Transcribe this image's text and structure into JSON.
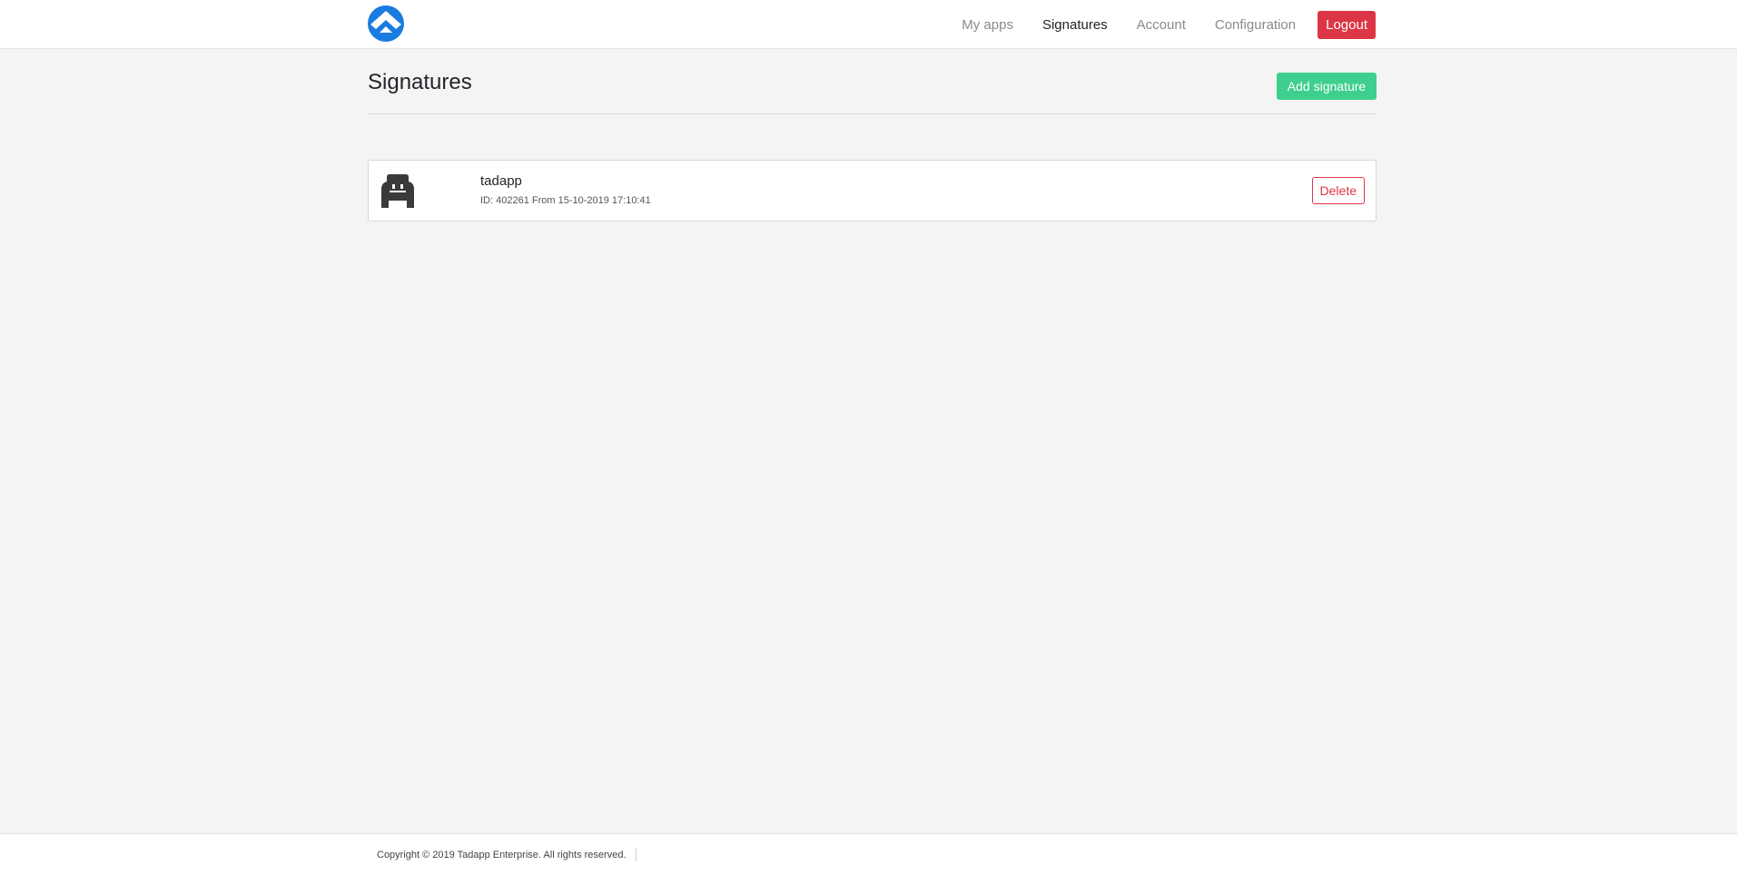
{
  "header": {
    "logo_icon": "app-logo-icon",
    "brand_color": "#1a7be0",
    "nav": [
      {
        "label": "My apps",
        "active": false
      },
      {
        "label": "Signatures",
        "active": true
      },
      {
        "label": "Account",
        "active": false
      },
      {
        "label": "Configuration",
        "active": false
      }
    ],
    "logout_label": "Logout",
    "logout_color": "#dc3545"
  },
  "main": {
    "title": "Signatures",
    "add_button_label": "Add signature",
    "add_button_color": "#3ecf8e",
    "signatures": [
      {
        "icon": "apple-app-icon",
        "name": "tadapp",
        "meta": "ID: 402261 From 15-10-2019 17:10:41",
        "delete_label": "Delete"
      }
    ]
  },
  "footer": {
    "copyright": "Copyright © 2019 Tadapp Enterprise. All rights reserved."
  }
}
